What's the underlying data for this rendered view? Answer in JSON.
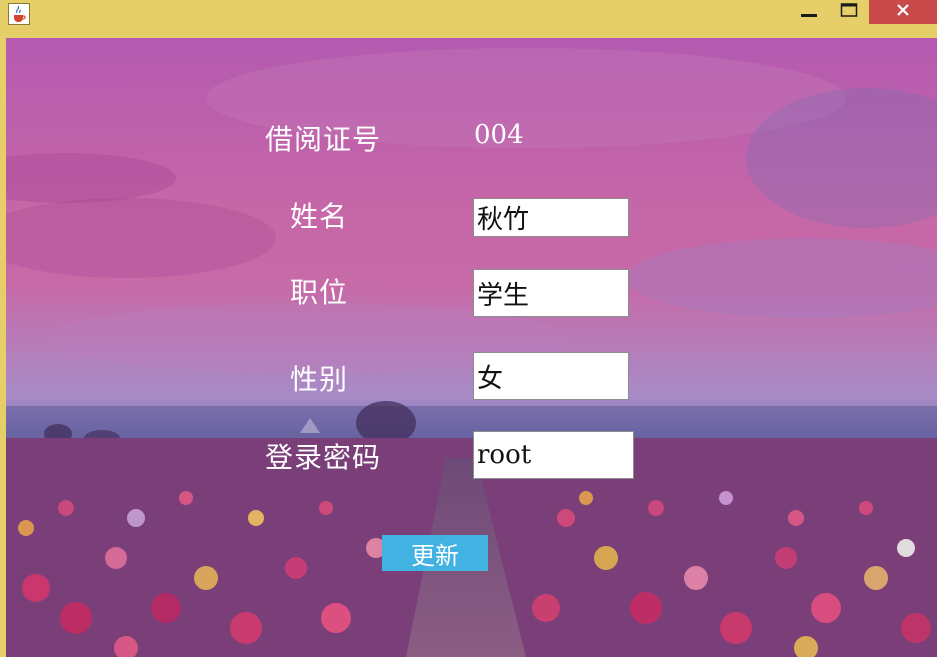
{
  "window": {
    "app_icon": "java-cup-icon",
    "controls": {
      "minimize_icon": "minimize-icon",
      "maximize_icon": "maximize-icon",
      "close_icon": "close-icon"
    }
  },
  "form": {
    "card_id": {
      "label": "借阅证号",
      "value": "004"
    },
    "name": {
      "label": "姓名",
      "value": "秋竹"
    },
    "position": {
      "label": "职位",
      "value": "学生"
    },
    "gender": {
      "label": "性别",
      "value": "女"
    },
    "password": {
      "label": "登录密码",
      "value": "root"
    },
    "update_button": "更新"
  },
  "colors": {
    "title_bar": "#e6cf68",
    "close_button": "#c94a4a",
    "update_button": "#41b2e2"
  }
}
